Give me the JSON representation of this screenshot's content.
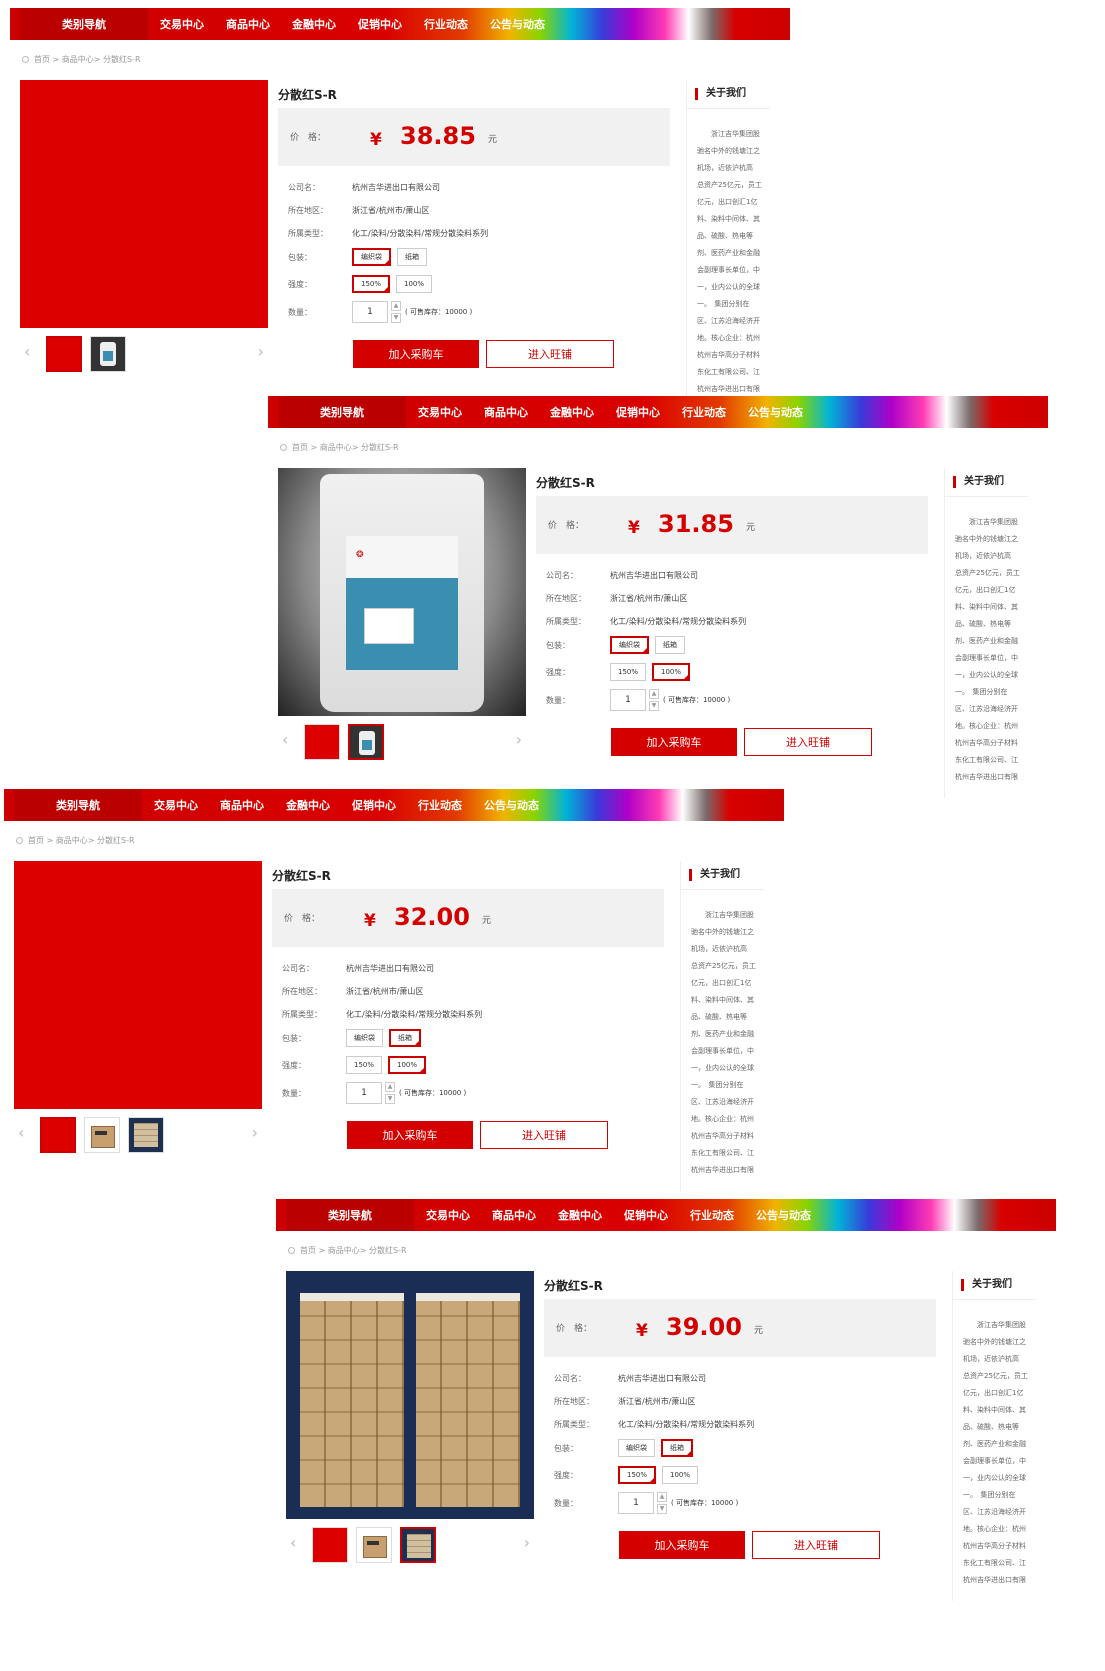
{
  "nav": {
    "category_label": "类别导航",
    "items": [
      "交易中心",
      "商品中心",
      "金融中心",
      "促销中心",
      "行业动态",
      "公告与动态"
    ]
  },
  "breadcrumb": "首页 > 商品中心> 分散红S-R",
  "product": {
    "title": "分散红S-R",
    "price_label": "价　格：",
    "currency": "¥",
    "unit": "元",
    "company_label": "公司名：",
    "company": "杭州吉华进出口有限公司",
    "region_label": "所在地区：",
    "region": "浙江省/杭州市/萧山区",
    "category_label": "所属类型：",
    "category": "化工/染料/分散染料/常规分散染料系列",
    "package_label": "包装：",
    "package_options": [
      "编织袋",
      "纸箱"
    ],
    "strength_label": "强度：",
    "strength_options": [
      "150%",
      "100%"
    ],
    "quantity_label": "数量：",
    "quantity": "1",
    "qty_up": "▲",
    "qty_down": "▼",
    "stock_text": "( 可售库存：10000 )",
    "cart_button": "加入采购车",
    "shop_button": "进入旺铺"
  },
  "about": {
    "heading": "关于我们",
    "text": "　　浙江吉华集团股\n驰名中外的钱塘江之\n机场，近依沪杭高\n总资产25亿元，员工\n亿元，出口创汇1亿\n料、染料中间体、其\n品、硫酸、热电等\n剂、医药产业和金融\n会副理事长单位，中\n一，业内公认的全球\n一。　集团分别在\n区、江苏沿海经济开\n地。核心企业：杭州\n杭州吉华高分子材料\n东化工有限公司、江\n杭州吉华进出口有限"
  },
  "views": [
    {
      "price": "38.85",
      "package_selected": "编织袋",
      "strength_selected": "150%",
      "image": "red placeholder",
      "thumb_icons": [
        "red-thumb",
        "bag-thumb"
      ],
      "active_thumb": 0
    },
    {
      "price": "31.85",
      "package_selected": "编织袋",
      "strength_selected": "100%",
      "image": "bag",
      "thumb_icons": [
        "red-thumb",
        "bag-thumb"
      ],
      "active_thumb": 1
    },
    {
      "price": "32.00",
      "package_selected": "纸箱",
      "strength_selected": "100%",
      "image": "red placeholder",
      "thumb_icons": [
        "red-thumb",
        "box-thumb",
        "container-thumb"
      ],
      "active_thumb": 0
    },
    {
      "price": "39.00",
      "package_selected": "纸箱",
      "strength_selected": "150%",
      "image": "container",
      "thumb_icons": [
        "red-thumb",
        "box-thumb",
        "container-thumb"
      ],
      "active_thumb": 2
    }
  ],
  "colors": {
    "accent": "#d40000",
    "nav_category": "#bb0000",
    "price_bg": "#f1f1f1"
  }
}
